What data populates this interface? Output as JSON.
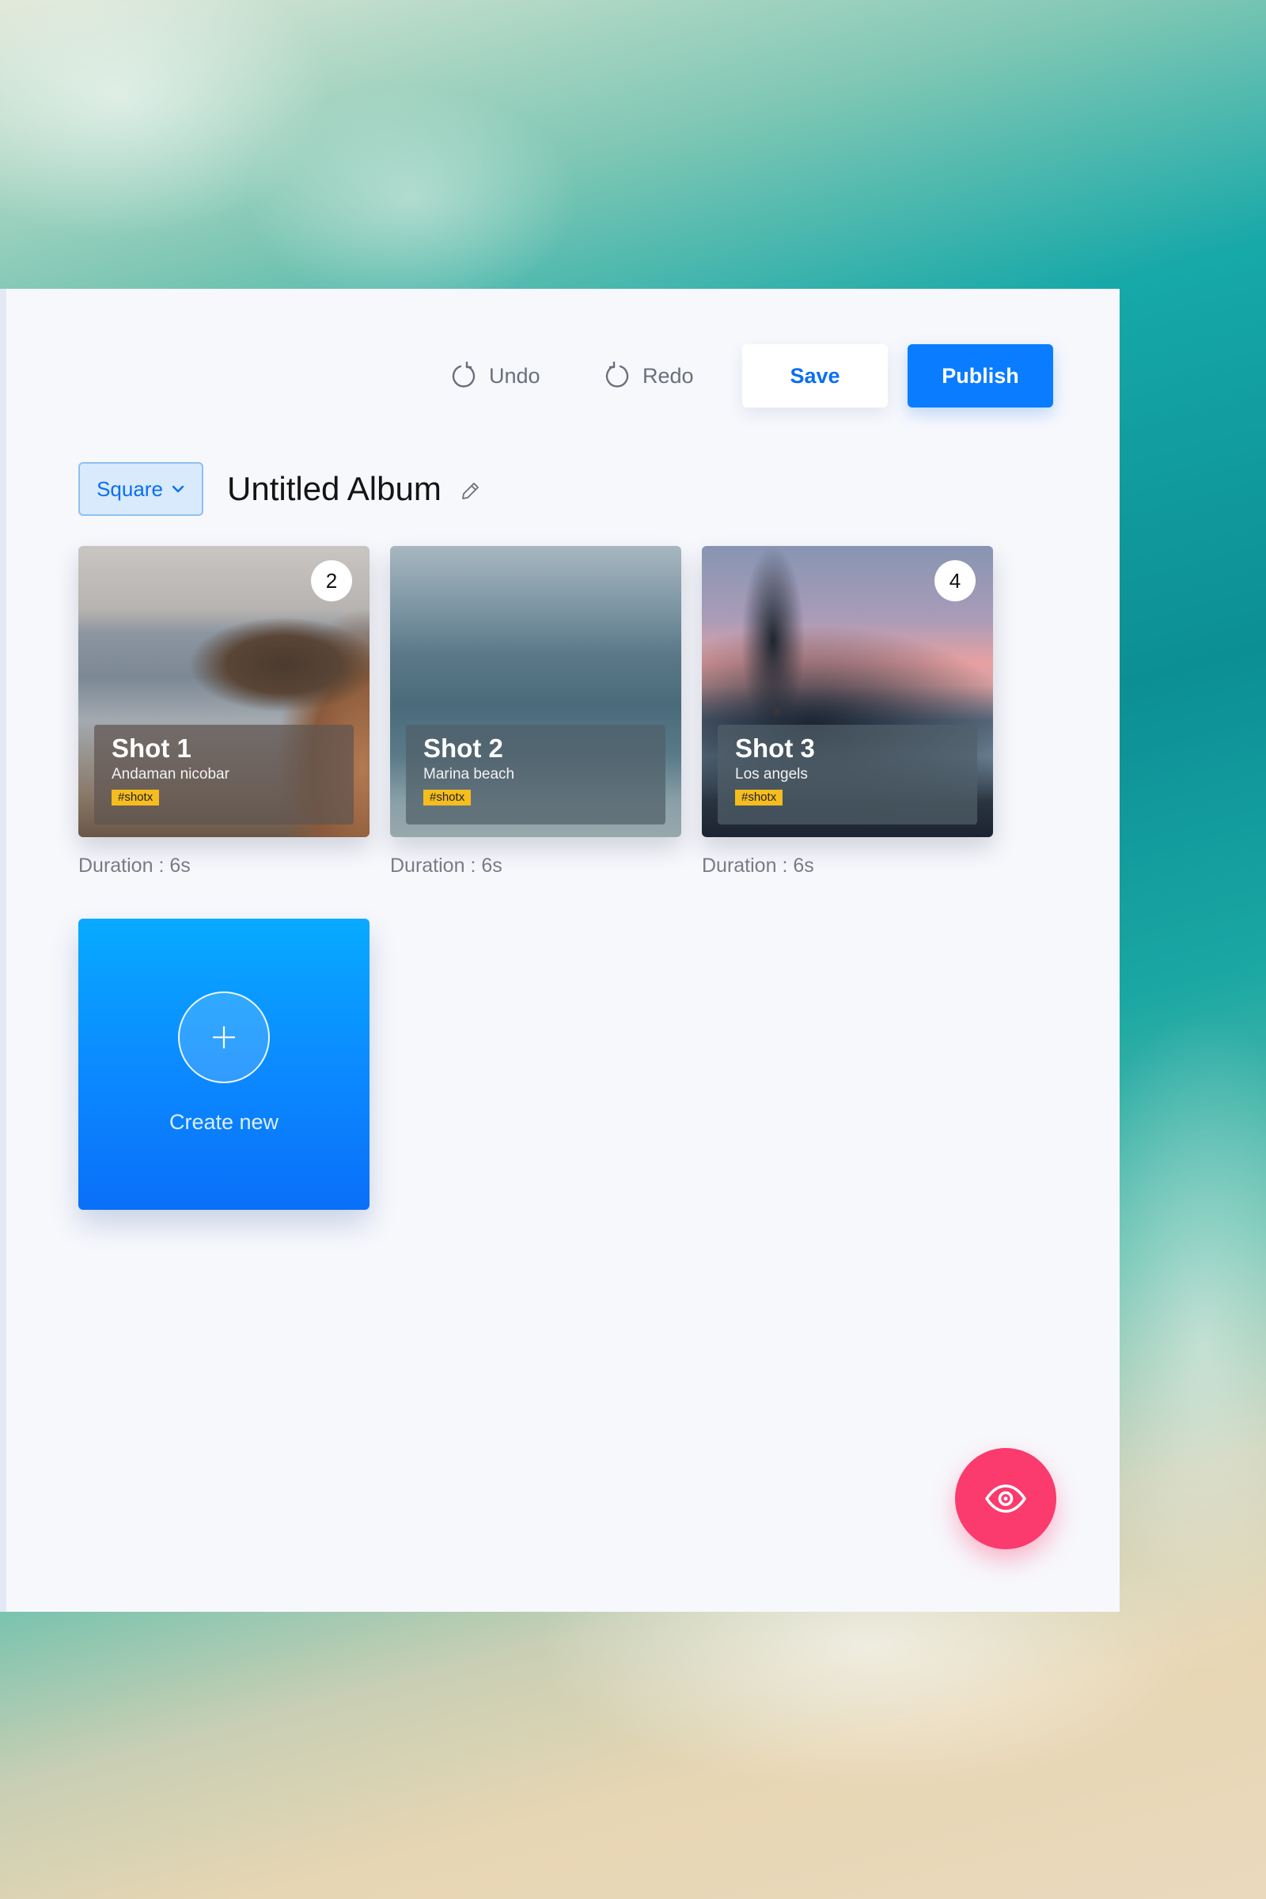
{
  "toolbar": {
    "undo_label": "Undo",
    "redo_label": "Redo",
    "save_label": "Save",
    "publish_label": "Publish"
  },
  "album": {
    "format": "Square",
    "title": "Untitled Album"
  },
  "shots": [
    {
      "title": "Shot 1",
      "location": "Andaman nicobar",
      "tag": "#shotx",
      "badge": "2",
      "duration": "Duration : 6s"
    },
    {
      "title": "Shot 2",
      "location": "Marina beach",
      "tag": "#shotx",
      "badge": "",
      "duration": "Duration : 6s"
    },
    {
      "title": "Shot 3",
      "location": "Los angels",
      "tag": "#shotx",
      "badge": "4",
      "duration": "Duration : 6s"
    }
  ],
  "create": {
    "label": "Create new"
  },
  "colors": {
    "accent": "#0a7cff",
    "fab": "#fb3a6d",
    "tag": "#f5bd1e"
  },
  "icons": [
    "undo-icon",
    "redo-icon",
    "chevron-down-icon",
    "pencil-icon",
    "plus-icon",
    "eye-icon"
  ]
}
